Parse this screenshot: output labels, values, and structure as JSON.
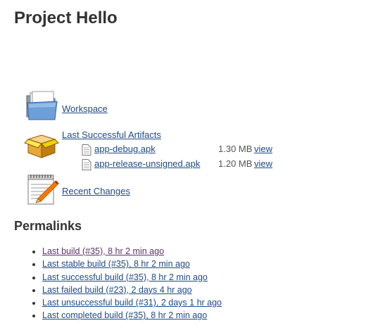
{
  "project": {
    "title": "Project Hello"
  },
  "links": {
    "workspace": {
      "label": "Workspace",
      "icon": "folder-icon"
    },
    "artifacts": {
      "label": "Last Successful Artifacts",
      "icon": "package-icon"
    },
    "changes": {
      "label": "Recent Changes",
      "icon": "notepad-icon"
    }
  },
  "artifacts": [
    {
      "name": "app-debug.apk",
      "size": "1.30 MB",
      "view": "view"
    },
    {
      "name": "app-release-unsigned.apk",
      "size": "1.20 MB",
      "view": "view"
    }
  ],
  "permalinks": {
    "heading": "Permalinks",
    "items": [
      {
        "label": "Last build (#35), 8 hr 2 min ago",
        "visited": true
      },
      {
        "label": "Last stable build (#35), 8 hr 2 min ago",
        "visited": false
      },
      {
        "label": "Last successful build (#35), 8 hr 2 min ago",
        "visited": false
      },
      {
        "label": "Last failed build (#23), 2 days 4 hr ago",
        "visited": false
      },
      {
        "label": "Last unsuccessful build (#31), 2 days 1 hr ago",
        "visited": false
      },
      {
        "label": "Last completed build (#35), 8 hr 2 min ago",
        "visited": false
      }
    ]
  },
  "colors": {
    "link": "#204a87",
    "visited_link": "#5c3566",
    "heading": "#333333"
  }
}
